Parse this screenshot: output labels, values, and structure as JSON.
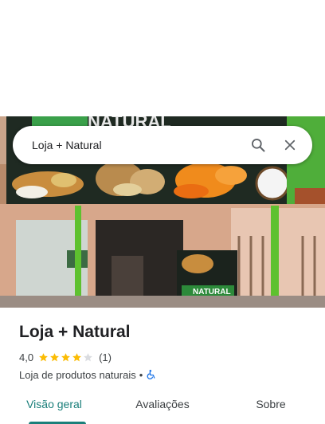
{
  "search": {
    "query": "Loja + Natural"
  },
  "place": {
    "name": "Loja + Natural",
    "rating": "4,0",
    "rating_value": 4,
    "review_count": "(1)",
    "category": "Loja de produtos naturais",
    "separator": "•",
    "accessibility_icon": "wheelchair-icon"
  },
  "photo": {
    "sign_text": "NATURAL"
  },
  "tabs": [
    {
      "label": "Visão geral",
      "active": true
    },
    {
      "label": "Avaliações",
      "active": false
    },
    {
      "label": "Sobre",
      "active": false
    }
  ],
  "colors": {
    "accent": "#1a7f7a",
    "star": "#fbbc04",
    "star_empty": "#dadce0",
    "text": "#202124"
  }
}
